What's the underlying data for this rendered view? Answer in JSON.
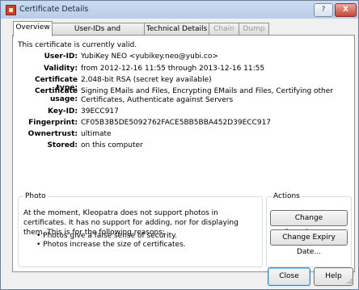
{
  "window": {
    "title": "Certificate Details",
    "help_btn": "?",
    "close_btn": "X"
  },
  "tabs": [
    {
      "label": "Overview",
      "active": true,
      "enabled": true
    },
    {
      "label": "User-IDs and Certifications",
      "active": false,
      "enabled": true
    },
    {
      "label": "Technical Details",
      "active": false,
      "enabled": true
    },
    {
      "label": "Chain",
      "active": false,
      "enabled": false
    },
    {
      "label": "Dump",
      "active": false,
      "enabled": false
    }
  ],
  "overview": {
    "status": "This certificate is currently valid.",
    "fields": [
      {
        "label": "User-ID:",
        "value": "YubiKey NEO <yubikey.neo@yubi.co>"
      },
      {
        "label": "Validity:",
        "value": "from 2012-12-16 11:55 through 2013-12-16 11:55"
      },
      {
        "label": "Certificate type:",
        "value": "2,048-bit RSA (secret key available)"
      },
      {
        "label": "Certificate usage:",
        "value": "Signing EMails and Files, Encrypting EMails and Files, Certifying other Certificates, Authenticate against Servers"
      },
      {
        "label": "Key-ID:",
        "value": "39ECC917"
      },
      {
        "label": "Fingerprint:",
        "value": "CF05B3B5DE5092762FACE5BB5BBA452D39ECC917"
      },
      {
        "label": "Ownertrust:",
        "value": "ultimate"
      },
      {
        "label": "Stored:",
        "value": "on this computer"
      }
    ]
  },
  "photo": {
    "title": "Photo",
    "description": "At the moment, Kleopatra does not support photos in certificates. It has no support for adding, nor for displaying them. This is for the following reasons:",
    "bullets": [
      "Photos give a false sense of security.",
      "Photos increase the size of certificates."
    ]
  },
  "actions": {
    "title": "Actions",
    "change_passphrase": "Change Passphrase...",
    "change_expiry": "Change Expiry Date..."
  },
  "footer": {
    "close": "Close",
    "help": "Help"
  }
}
